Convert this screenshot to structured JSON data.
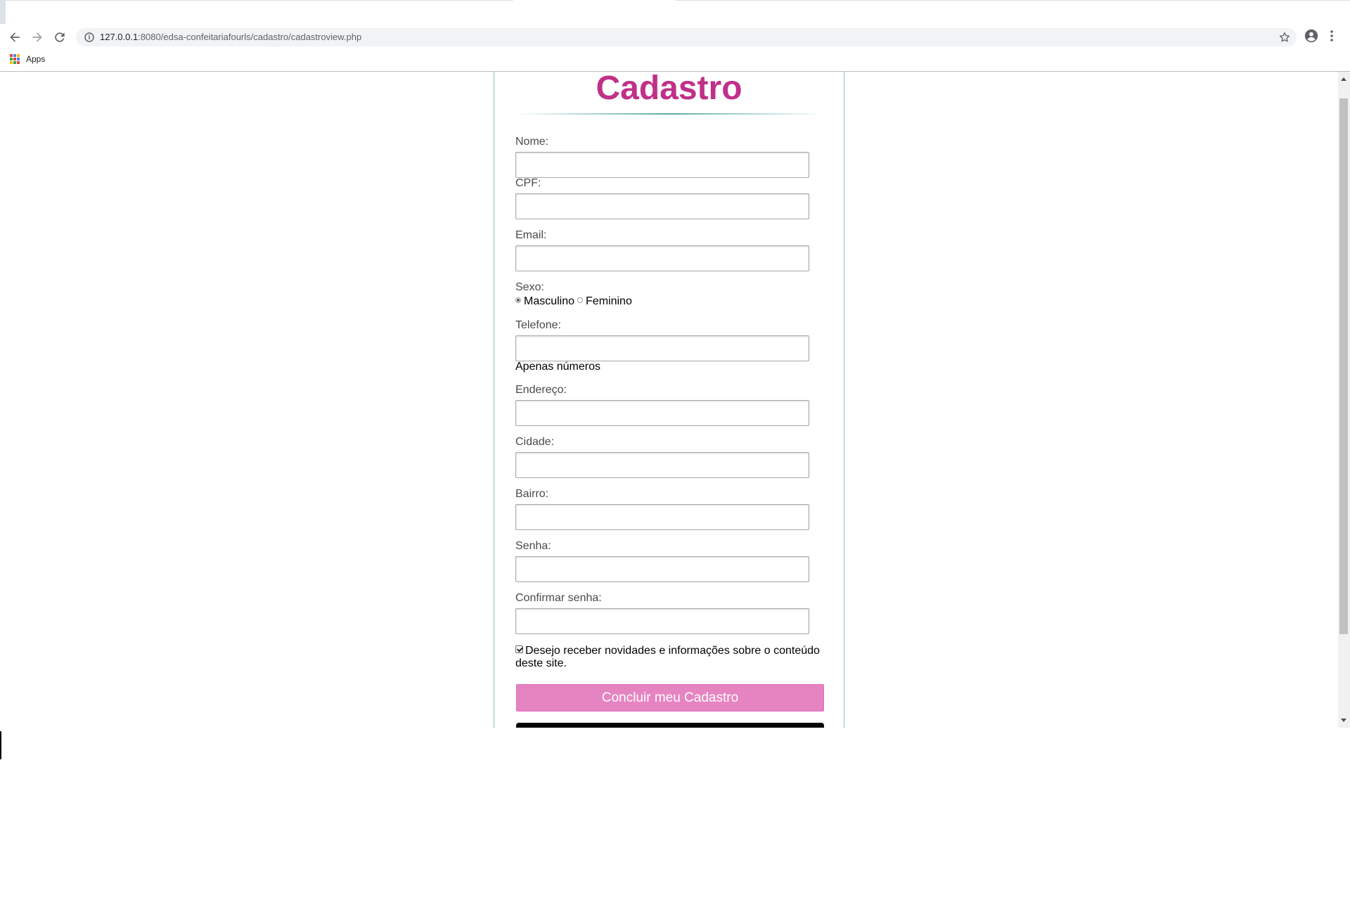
{
  "browser": {
    "url_host": "127.0.0.1",
    "url_rest": ":8080/edsa-confeitariafourls/cadastro/cadastroview.php",
    "bookmarks": {
      "apps_label": "Apps"
    },
    "icons": {
      "back": "arrow-left-icon",
      "forward": "arrow-right-icon",
      "reload": "reload-icon",
      "info": "info-icon",
      "star": "star-icon",
      "profile": "account-icon",
      "menu": "more-vert-icon",
      "apps": "apps-grid-icon"
    }
  },
  "page": {
    "title": "Cadastro",
    "fields": {
      "nome": {
        "label": "Nome:",
        "value": ""
      },
      "cpf": {
        "label": "CPF:",
        "value": ""
      },
      "email": {
        "label": "Email:",
        "value": ""
      },
      "sexo": {
        "label": "Sexo:",
        "options": [
          "Masculino",
          "Feminino"
        ],
        "selected": "Masculino"
      },
      "telefone": {
        "label": "Telefone:",
        "value": "",
        "hint": "Apenas números"
      },
      "endereco": {
        "label": "Endereço:",
        "value": ""
      },
      "cidade": {
        "label": "Cidade:",
        "value": ""
      },
      "bairro": {
        "label": "Bairro:",
        "value": ""
      },
      "senha": {
        "label": "Senha:",
        "value": ""
      },
      "confirmar_senha": {
        "label": "Confirmar senha:",
        "value": ""
      }
    },
    "newsletter": {
      "label": "Desejo receber novidades e informações sobre o conteúdo deste site.",
      "checked": true
    },
    "submit_label": "Concluir meu Cadastro"
  },
  "colors": {
    "title": "#c03089",
    "submit_bg": "#e684c2",
    "card_border": "#8fbfbf"
  }
}
